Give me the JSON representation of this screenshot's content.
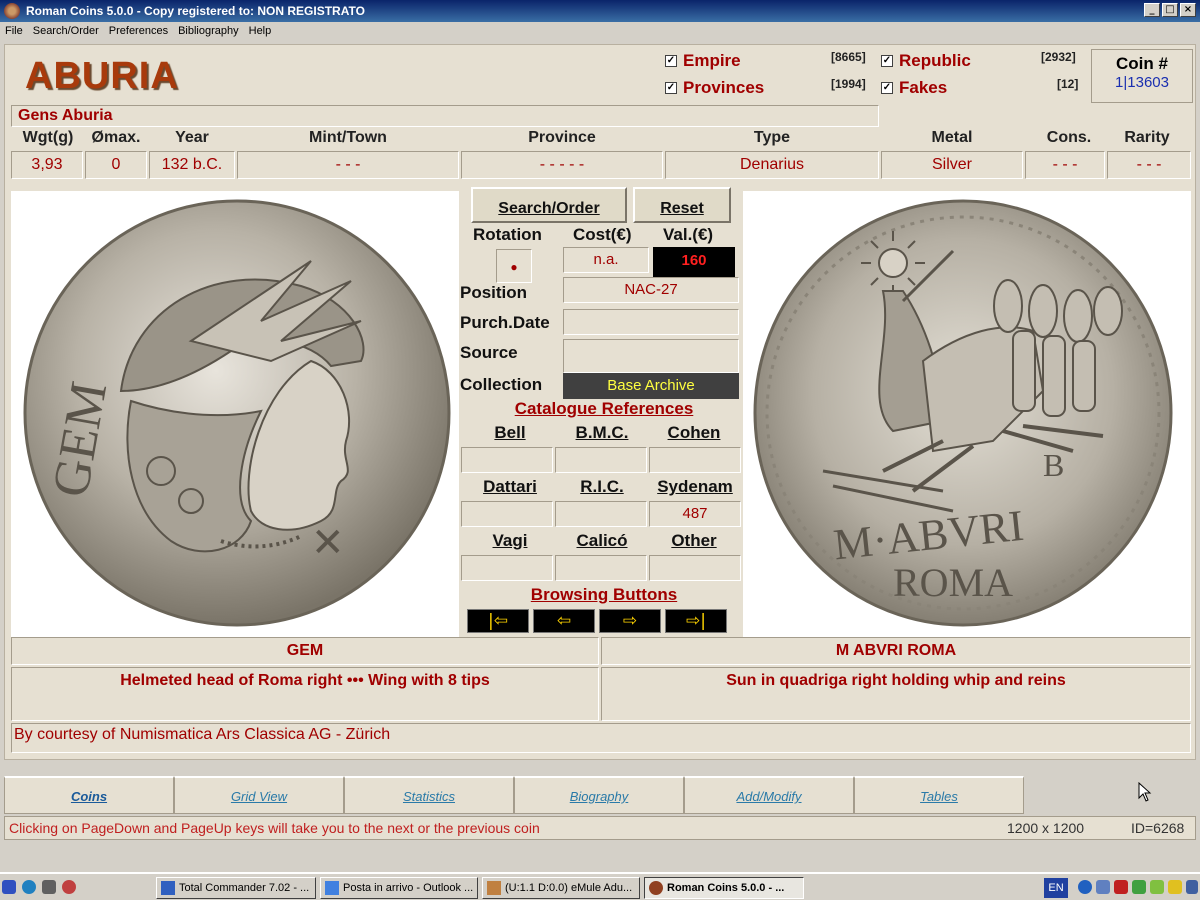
{
  "window": {
    "title": "Roman Coins 5.0.0 - Copy registered to:  NON REGISTRATO",
    "minimize": "_",
    "maximize": "□",
    "close": "×"
  },
  "menu": [
    "File",
    "Search/Order",
    "Preferences",
    "Bibliography",
    "Help"
  ],
  "coin": {
    "name": "ABURIA",
    "gens": "Gens Aburia",
    "number_label": "Coin #",
    "number_value": "1|13603"
  },
  "filters": {
    "empire": {
      "label": "Empire",
      "count": "[8665]",
      "checked": "✓"
    },
    "provinces": {
      "label": "Provinces",
      "count": "[1994]",
      "checked": "✓"
    },
    "republic": {
      "label": "Republic",
      "count": "[2932]",
      "checked": "✓"
    },
    "fakes": {
      "label": "Fakes",
      "count": "[12]",
      "checked": "✓"
    }
  },
  "details_headers": [
    "Wgt(g)",
    "Ømax.",
    "Year",
    "Mint/Town",
    "Province",
    "Type",
    "Metal",
    "Cons.",
    "Rarity"
  ],
  "details_values": [
    "3,93",
    "0",
    "132 b.C.",
    "- - -",
    "- - - - -",
    "Denarius",
    "Silver",
    "- - -",
    "- - -"
  ],
  "center": {
    "search_label": "Search/Order",
    "reset_label": "Reset",
    "rotation_label": "Rotation",
    "cost_label": "Cost(€)",
    "val_label": "Val.(€)",
    "rotation_dot": "●",
    "cost_value": "n.a.",
    "val_value": "160",
    "position_label": "Position",
    "position_value": "NAC-27",
    "purch_label": "Purch.Date",
    "purch_value": "",
    "source_label": "Source",
    "source_value": "",
    "collection_label": "Collection",
    "collection_value": "Base Archive",
    "cat_refs_label": "Catalogue References",
    "refs_row1": [
      "Bell",
      "B.M.C.",
      "Cohen"
    ],
    "refs_row1_values": [
      "",
      "",
      ""
    ],
    "refs_row2": [
      "Dattari",
      "R.I.C.",
      "Sydenam"
    ],
    "refs_row2_values": [
      "",
      "",
      "487"
    ],
    "refs_row3": [
      "Vagi",
      "Calicó",
      "Other"
    ],
    "refs_row3_values": [
      "",
      "",
      ""
    ],
    "browse_label": "Browsing Buttons",
    "nav": [
      "|⇦",
      "⇦",
      "⇨",
      "⇨|"
    ]
  },
  "obverse": {
    "legend": "GEM",
    "description": "Helmeted head of Roma right ••• Wing with 8 tips"
  },
  "reverse": {
    "legend": "M ABVRI ROMA",
    "description": "Sun in quadriga right holding whip and reins"
  },
  "courtesy": "By courtesy of Numismatica Ars Classica AG - Zürich",
  "tabs": [
    "Coins",
    "Grid View",
    "Statistics",
    "Biography",
    "Add/Modify",
    "Tables"
  ],
  "status": {
    "hint": "Clicking on PageDown and PageUp keys will take you to the next or the previous coin",
    "resolution": "1200 x 1200",
    "id": "ID=6268"
  },
  "taskbar": {
    "tasks": [
      "Total Commander 7.02 - ...",
      "Posta in arrivo - Outlook ...",
      "(U:1.1 D:0.0) eMule Adu...",
      "Roman Coins 5.0.0 - ..."
    ],
    "lang": "EN"
  }
}
